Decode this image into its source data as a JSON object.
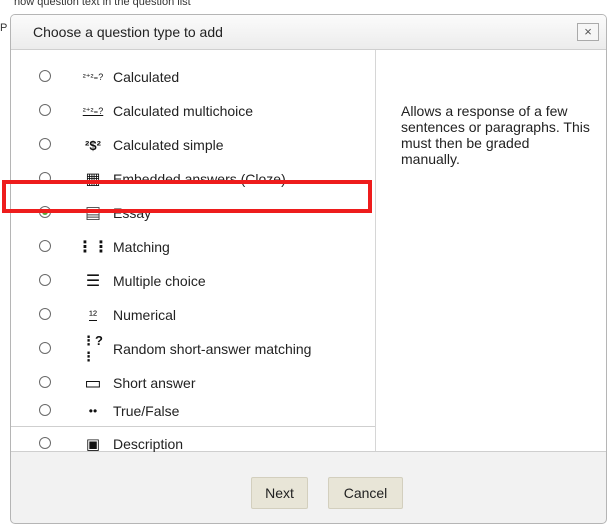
{
  "background": {
    "text": "now question text in the question list",
    "caret": "P"
  },
  "dialog": {
    "title": "Choose a question type to add",
    "close_label": "×",
    "options": [
      {
        "label": "Calculated",
        "icon": "calculated-icon",
        "glyph": "²⁺²₌?",
        "checked": false
      },
      {
        "label": "Calculated multichoice",
        "icon": "calculated-multichoice-icon",
        "glyph": "²⁺²₌?",
        "checked": false
      },
      {
        "label": "Calculated simple",
        "icon": "calculated-simple-icon",
        "glyph": "²$²",
        "checked": false
      },
      {
        "label": "Embedded answers (Cloze)",
        "icon": "cloze-icon",
        "glyph": "▦",
        "checked": false
      },
      {
        "label": "Essay",
        "icon": "essay-icon",
        "glyph": "▤",
        "checked": true
      },
      {
        "label": "Matching",
        "icon": "matching-icon",
        "glyph": "⋮⋮",
        "checked": false
      },
      {
        "label": "Multiple choice",
        "icon": "multiple-choice-icon",
        "glyph": "☰",
        "checked": false
      },
      {
        "label": "Numerical",
        "icon": "numerical-icon",
        "glyph": "¹²",
        "checked": false
      },
      {
        "label": "Random short-answer matching",
        "icon": "random-matching-icon",
        "glyph": "⋮?⋮",
        "checked": false
      },
      {
        "label": "Short answer",
        "icon": "short-answer-icon",
        "glyph": "▭",
        "checked": false
      },
      {
        "label": "True/False",
        "icon": "true-false-icon",
        "glyph": "••",
        "checked": false
      },
      {
        "label": "Description",
        "icon": "description-icon",
        "glyph": "▣",
        "checked": false
      }
    ],
    "summary": "Allows a response of a few sentences or paragraphs. This must then be graded manually.",
    "buttons": {
      "next": "Next",
      "cancel": "Cancel"
    }
  },
  "colors": {
    "highlight": "#ee1c1c",
    "selected_radio": "#5aa53a",
    "button_bg": "#e8e5d7"
  }
}
